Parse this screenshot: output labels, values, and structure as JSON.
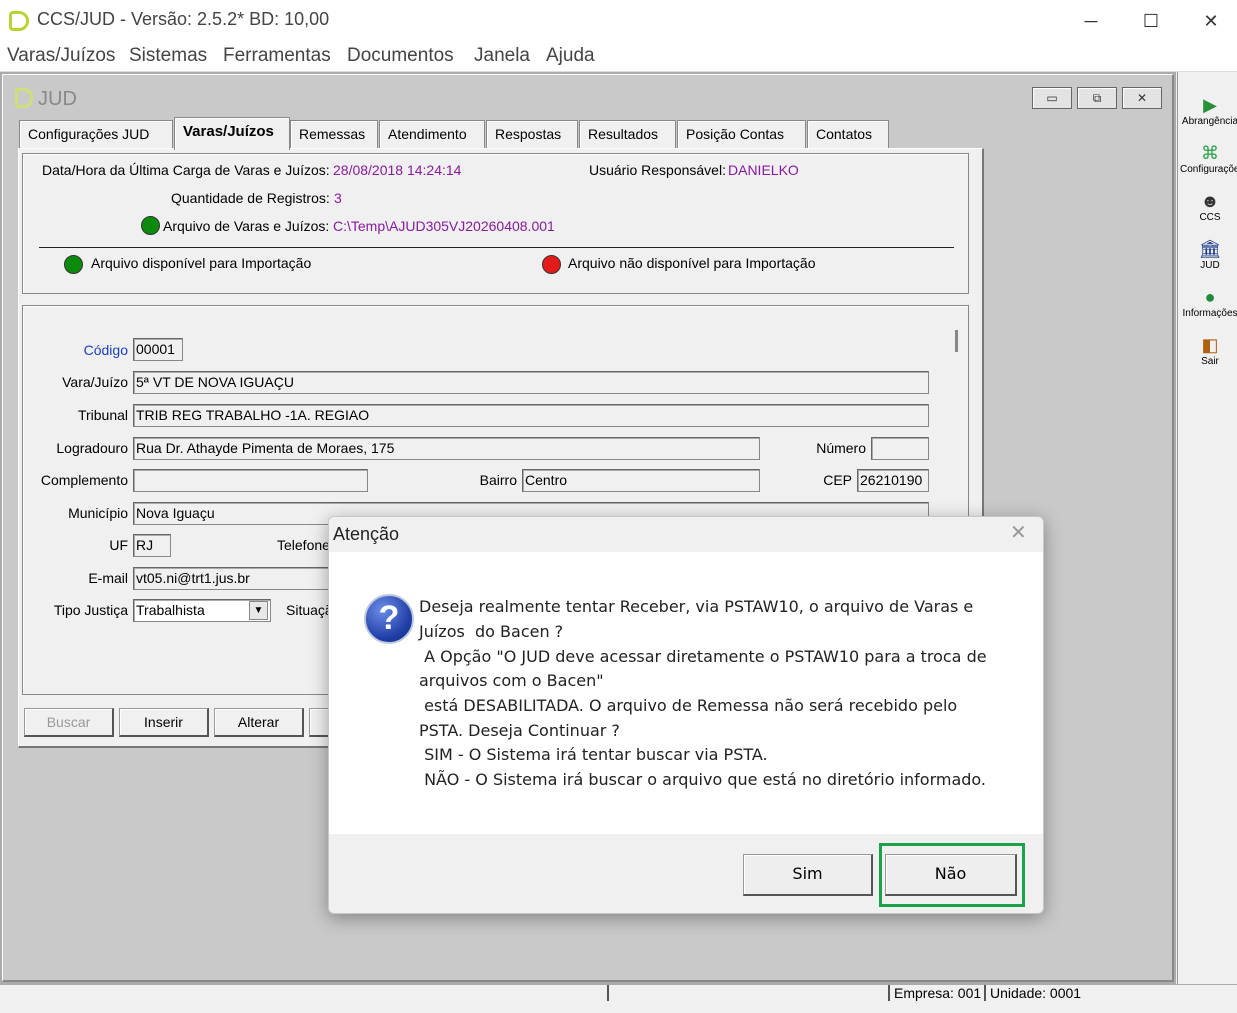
{
  "window": {
    "title": "CCS/JUD - Versão: 2.5.2* BD: 10,00",
    "minimize": "─",
    "maximize": "☐",
    "close": "✕"
  },
  "menu": [
    "Varas/Juízos",
    "Sistemas",
    "Ferramentas",
    "Documentos",
    "Janela",
    "Ajuda"
  ],
  "child_window": {
    "title": "JUD",
    "btn_min": "▭",
    "btn_restore": "⧉",
    "btn_close": "✕"
  },
  "tabs": [
    {
      "label": "Configurações JUD"
    },
    {
      "label": "Varas/Juízos",
      "active": true
    },
    {
      "label": "Remessas"
    },
    {
      "label": "Atendimento"
    },
    {
      "label": "Respostas"
    },
    {
      "label": "Resultados"
    },
    {
      "label": "Posição Contas"
    },
    {
      "label": "Contatos"
    }
  ],
  "info": {
    "last_load_label": "Data/Hora da Última Carga de Varas e Juízos:",
    "last_load_value": "28/08/2018 14:24:14",
    "user_label": "Usuário Responsável:",
    "user_value": "DANIELKO",
    "count_label": "Quantidade de Registros:",
    "count_value": "3",
    "file_label": "Arquivo de Varas e Juízos:",
    "file_value": "C:\\Temp\\AJUD305VJ20260408.001",
    "legend_available": "Arquivo disponível para Importação",
    "legend_unavailable": "Arquivo não disponível para Importação"
  },
  "form": {
    "codigo_label": "Código",
    "codigo_value": "00001",
    "vara_label": "Vara/Juízo",
    "vara_value": "5ª VT DE NOVA IGUAÇU",
    "tribunal_label": "Tribunal",
    "tribunal_value": "TRIB REG TRABALHO -1A. REGIAO",
    "logradouro_label": "Logradouro",
    "logradouro_value": "Rua Dr. Athayde Pimenta de Moraes, 175",
    "numero_label": "Número",
    "numero_value": "",
    "complemento_label": "Complemento",
    "complemento_value": "",
    "bairro_label": "Bairro",
    "bairro_value": "Centro",
    "cep_label": "CEP",
    "cep_value": "26210190",
    "municipio_label": "Município",
    "municipio_value": "Nova Iguaçu",
    "uf_label": "UF",
    "uf_value": "RJ",
    "telefone_label": "Telefone",
    "email_label": "E-mail",
    "email_value": "vt05.ni@trt1.jus.br",
    "tipo_label": "Tipo Justiça",
    "tipo_value": "Trabalhista",
    "situacao_label": "Situação"
  },
  "buttons": {
    "buscar": "Buscar",
    "inserir": "Inserir",
    "alterar": "Alterar"
  },
  "toolbar": [
    {
      "label": "Abrangência",
      "icon": "abrangencia-icon",
      "glyph": "▶"
    },
    {
      "label": "Configurações",
      "icon": "config-icon",
      "glyph": "⌘"
    },
    {
      "label": "CCS",
      "icon": "ccs-icon",
      "glyph": "☻"
    },
    {
      "label": "JUD",
      "icon": "jud-icon",
      "glyph": "🏛"
    },
    {
      "label": "Informações",
      "icon": "info-globe-icon",
      "glyph": "●"
    },
    {
      "label": "Sair",
      "icon": "exit-door-icon",
      "glyph": "◧"
    }
  ],
  "status": {
    "empresa": "Empresa: 001",
    "unidade": "Unidade: 0001"
  },
  "dialog": {
    "title": "Atenção",
    "close": "✕",
    "icon": "?",
    "lines": [
      "Deseja realmente tentar Receber, via PSTAW10, o arquivo de Varas e",
      "Juízos  do Bacen ?",
      " A Opção \"O JUD deve acessar diretamente o PSTAW10 para a troca de",
      "arquivos com o Bacen\"",
      " está DESABILITADA. O arquivo de Remessa não será recebido pelo",
      "PSTA. Deseja Continuar ?",
      " SIM - O Sistema irá tentar buscar via PSTA.",
      " NÃO - O Sistema irá buscar o arquivo que está no diretório informado."
    ],
    "yes": "Sim",
    "no": "Não"
  },
  "colors": {
    "highlight": "#1aa34a",
    "purple_value": "#8a1a9f",
    "available": "#0c8a0c",
    "unavailable": "#e41b1b"
  }
}
